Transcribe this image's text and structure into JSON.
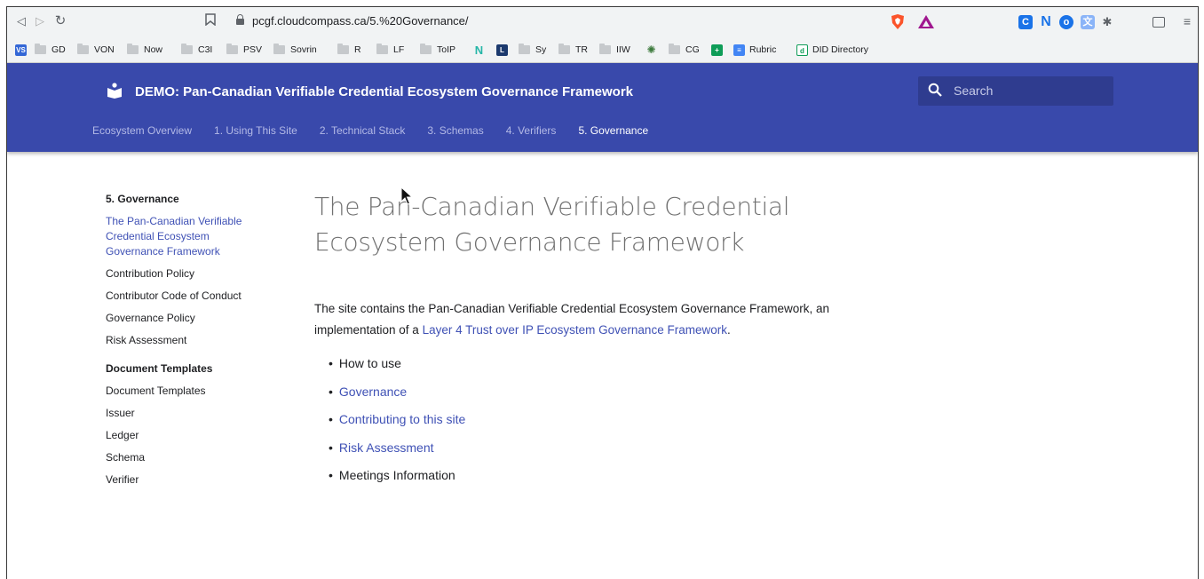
{
  "browser": {
    "url": "pcgf.cloudcompass.ca/5.%20Governance/",
    "bookmarks": [
      {
        "label": "",
        "icon": "vs-icon"
      },
      {
        "label": "GD"
      },
      {
        "label": "VON"
      },
      {
        "label": "Now"
      },
      {
        "label": "C3I"
      },
      {
        "label": "PSV"
      },
      {
        "label": "Sovrin"
      },
      {
        "label": "R"
      },
      {
        "label": "LF"
      },
      {
        "label": "ToIP"
      },
      {
        "label": "",
        "icon": "n-icon"
      },
      {
        "label": "",
        "icon": "l-icon"
      },
      {
        "label": "Sy"
      },
      {
        "label": "TR"
      },
      {
        "label": "IIW"
      },
      {
        "label": "",
        "icon": "bug-icon"
      },
      {
        "label": "CG"
      },
      {
        "label": "",
        "icon": "green-icon"
      },
      {
        "label": "Rubric",
        "icon": "doc-icon"
      },
      {
        "label": "DID Directory",
        "icon": "did-icon"
      }
    ],
    "colors": {
      "chrome_bg": "#f1f3f4",
      "brave": "#fb542b"
    }
  },
  "site": {
    "title": "DEMO: Pan-Canadian Verifiable Credential Ecosystem Governance Framework",
    "search_placeholder": "Search",
    "tabs": [
      {
        "label": "Ecosystem Overview"
      },
      {
        "label": "1. Using This Site"
      },
      {
        "label": "2. Technical Stack"
      },
      {
        "label": "3. Schemas"
      },
      {
        "label": "4. Verifiers"
      },
      {
        "label": "5. Governance",
        "active": true
      }
    ],
    "colors": {
      "header": "#3949ab",
      "accent": "#3f51b5"
    }
  },
  "sidebar": {
    "section1_heading": "5. Governance",
    "section1_active": "The Pan-Canadian Verifiable Credential Ecosystem Governance Framework",
    "section1_items": [
      "Contribution Policy",
      "Contributor Code of Conduct",
      "Governance Policy",
      "Risk Assessment"
    ],
    "section2_heading": "Document Templates",
    "section2_items": [
      "Document Templates",
      "Issuer",
      "Ledger",
      "Schema",
      "Verifier"
    ]
  },
  "main": {
    "title_line1": "The Pan-Canadian Verifiable Credential",
    "title_line2": "Ecosystem Governance Framework",
    "intro_before": "The site contains the Pan-Canadian Verifiable Credential Ecosystem Governance Framework, an implementation of a ",
    "intro_link": "Layer 4 Trust over IP Ecosystem Governance Framework",
    "intro_after": ".",
    "bullets": [
      {
        "label": "How to use",
        "link": false
      },
      {
        "label": "Governance",
        "link": true
      },
      {
        "label": "Contributing to this site",
        "link": true
      },
      {
        "label": "Risk Assessment",
        "link": true
      },
      {
        "label": "Meetings Information",
        "link": false
      }
    ]
  }
}
